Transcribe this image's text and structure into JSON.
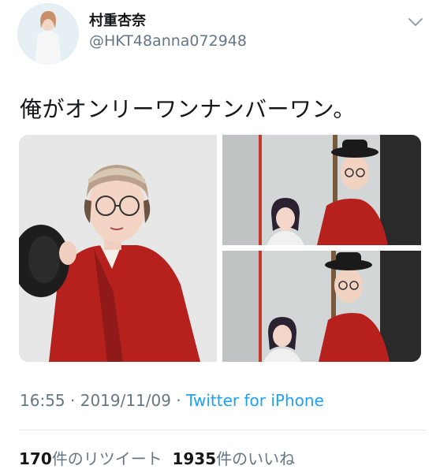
{
  "profile": {
    "display_name": "村重杏奈",
    "handle": "@HKT48anna072948"
  },
  "header": {
    "menu_icon": "chevron-down-icon"
  },
  "tweet": {
    "text": "俺がオンリーワンナンバーワン。"
  },
  "meta": {
    "time": "16:55",
    "sep1": " · ",
    "date": "2019/11/09",
    "sep2": " · ",
    "source": "Twitter for iPhone"
  },
  "stats": {
    "retweet_count": "170",
    "retweet_label": "件のリツイート",
    "like_count": "1935",
    "like_label": "件のいいね"
  },
  "colors": {
    "link": "#1da1f2",
    "secondary_text": "#657786",
    "primary_text": "#14171a",
    "robe": "#b6211d"
  }
}
